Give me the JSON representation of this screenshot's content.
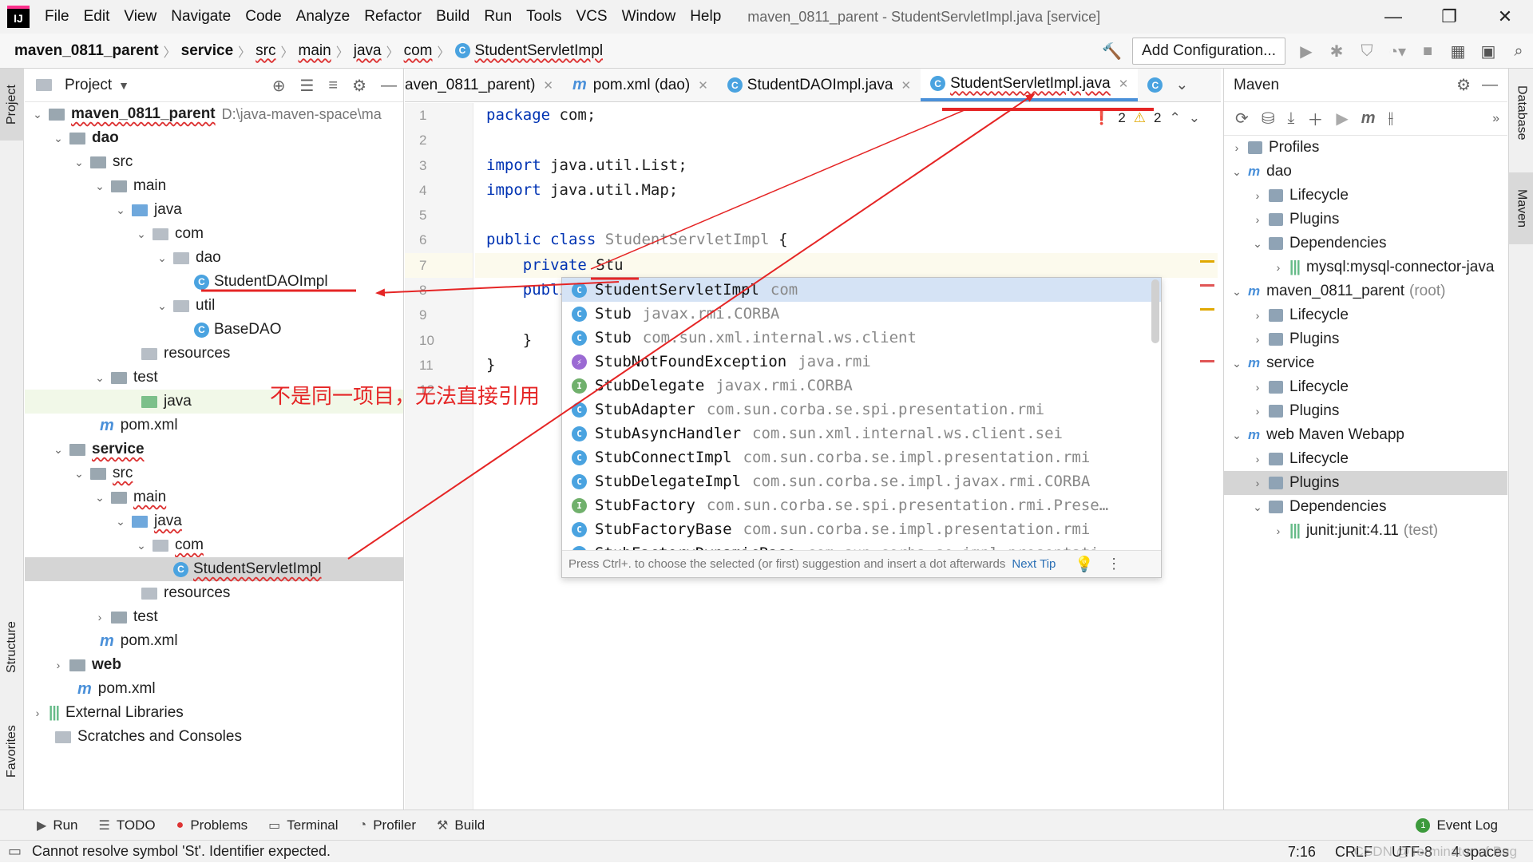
{
  "menubar": {
    "logo": "IJ",
    "items": [
      "File",
      "Edit",
      "View",
      "Navigate",
      "Code",
      "Analyze",
      "Refactor",
      "Build",
      "Run",
      "Tools",
      "VCS",
      "Window",
      "Help"
    ],
    "window_title": "maven_0811_parent - StudentServletImpl.java [service]",
    "controls": [
      "—",
      "❐",
      "✕"
    ]
  },
  "navbar": {
    "crumbs": [
      "maven_0811_parent",
      "service",
      "src",
      "main",
      "java",
      "com",
      "StudentServletImpl"
    ],
    "add_configuration": "Add Configuration..."
  },
  "left_strip": {
    "project_tab": "Project",
    "structure_tab": "Structure",
    "favorites_tab": "Favorites"
  },
  "project": {
    "title": "Project",
    "root_path": "D:\\java-maven-space\\ma",
    "tree": [
      "maven_0811_parent",
      "dao",
      "src",
      "main",
      "java",
      "com",
      "dao",
      "StudentDAOImpl",
      "util",
      "BaseDAO",
      "resources",
      "test",
      "java",
      "pom.xml",
      "service",
      "src",
      "main",
      "java",
      "com",
      "StudentServletImpl",
      "resources",
      "test",
      "pom.xml",
      "web",
      "pom.xml",
      "External Libraries",
      "Scratches and Consoles"
    ]
  },
  "editor": {
    "tabs": [
      {
        "label": "aven_0811_parent)"
      },
      {
        "label": "pom.xml (dao)"
      },
      {
        "label": "StudentDAOImpl.java"
      },
      {
        "label": "StudentServletImpl.java"
      }
    ],
    "line_numbers": [
      "1",
      "2",
      "3",
      "4",
      "5",
      "6",
      "7",
      "8",
      "9",
      "10",
      "11",
      "12"
    ],
    "code": {
      "l1_kw": "package",
      "l1_rest": " com;",
      "l3_kw": "import",
      "l3_rest": " java.util.List;",
      "l4_kw": "import",
      "l4_rest": " java.util.Map;",
      "l6_kw": "public class",
      "l6_name": " StudentServletImpl",
      "l6_rest": " {",
      "l7_kw": "    private",
      "l7_rest": " Stu",
      "l8_kw": "    publi",
      "l10_rest": "    }",
      "l11_rest": "}"
    },
    "errors": "2",
    "warnings": "2"
  },
  "completion": {
    "items": [
      {
        "icon": "C",
        "kind": "c",
        "name": "StudentServletImpl",
        "pkg": "com"
      },
      {
        "icon": "C",
        "kind": "c",
        "name": "Stub",
        "pkg": "javax.rmi.CORBA"
      },
      {
        "icon": "C",
        "kind": "c",
        "name": "Stub",
        "pkg": "com.sun.xml.internal.ws.client"
      },
      {
        "icon": "⚡",
        "kind": "e",
        "name": "StubNotFoundException",
        "pkg": "java.rmi"
      },
      {
        "icon": "I",
        "kind": "i",
        "name": "StubDelegate",
        "pkg": "javax.rmi.CORBA"
      },
      {
        "icon": "C",
        "kind": "c",
        "name": "StubAdapter",
        "pkg": "com.sun.corba.se.spi.presentation.rmi"
      },
      {
        "icon": "C",
        "kind": "c",
        "name": "StubAsyncHandler",
        "pkg": "com.sun.xml.internal.ws.client.sei"
      },
      {
        "icon": "C",
        "kind": "c",
        "name": "StubConnectImpl",
        "pkg": "com.sun.corba.se.impl.presentation.rmi"
      },
      {
        "icon": "C",
        "kind": "c",
        "name": "StubDelegateImpl",
        "pkg": "com.sun.corba.se.impl.javax.rmi.CORBA"
      },
      {
        "icon": "I",
        "kind": "i",
        "name": "StubFactory",
        "pkg": "com.sun.corba.se.spi.presentation.rmi.Prese…"
      },
      {
        "icon": "C",
        "kind": "c",
        "name": "StubFactoryBase",
        "pkg": "com.sun.corba.se.impl.presentation.rmi"
      },
      {
        "icon": "C",
        "kind": "c",
        "name": "StubFactoryDynamicBase",
        "pkg": "com.sun.corba.se.impl.presentati"
      }
    ],
    "footer_hint": "Press Ctrl+. to choose the selected (or first) suggestion and insert a dot afterwards",
    "next_tip": "Next Tip"
  },
  "maven": {
    "title": "Maven",
    "tree": [
      "Profiles",
      "dao",
      "Lifecycle",
      "Plugins",
      "Dependencies",
      "mysql:mysql-connector-java",
      "maven_0811_parent",
      "(root)",
      "Lifecycle",
      "Plugins",
      "service",
      "Lifecycle",
      "Plugins",
      "web Maven Webapp",
      "Lifecycle",
      "Plugins",
      "Dependencies",
      "junit:junit:4.11",
      "(test)"
    ]
  },
  "right_strip": {
    "database_tab": "Database",
    "maven_tab": "Maven"
  },
  "bottom_tools": [
    "Run",
    "TODO",
    "Problems",
    "Terminal",
    "Profiler",
    "Build"
  ],
  "event_log": "Event Log",
  "status": {
    "message": "Cannot resolve symbol 'St'. Identifier expected.",
    "position": "7:16",
    "line_sep": "CRLF",
    "encoding": "UTF-8",
    "indent": "4 spaces",
    "watermark": "CSDN @Terminator of Bug"
  },
  "annotation": {
    "text": "不是同一项目，无法直接引用",
    "color": "#e52525"
  }
}
